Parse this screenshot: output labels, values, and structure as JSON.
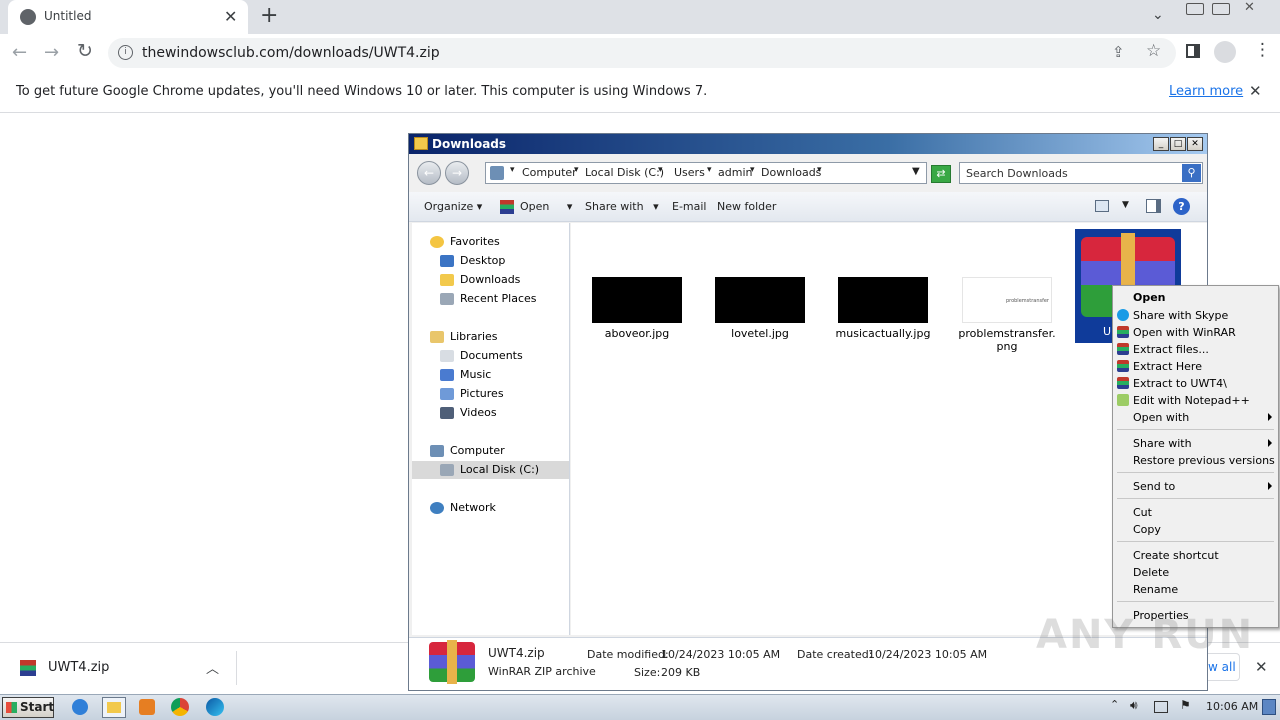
{
  "browser": {
    "tab_title": "Untitled",
    "new_tab_symbol": "+",
    "url": "thewindowsclub.com/downloads/UWT4.zip",
    "infobar_message": "To get future Google Chrome updates, you'll need Windows 10 or later. This computer is using Windows 7.",
    "infobar_link": "Learn more",
    "download_item": "UWT4.zip",
    "show_all_fragment": "w all"
  },
  "explorer": {
    "title": "Downloads",
    "breadcrumb": [
      "Computer",
      "Local Disk (C:)",
      "Users",
      "admin",
      "Downloads"
    ],
    "search_placeholder": "Search Downloads",
    "commands": {
      "organize": "Organize",
      "open": "Open",
      "share_with": "Share with",
      "email": "E-mail",
      "new_folder": "New folder"
    },
    "nav": {
      "favorites": "Favorites",
      "desktop": "Desktop",
      "downloads": "Downloads",
      "recent_places": "Recent Places",
      "libraries": "Libraries",
      "documents": "Documents",
      "music": "Music",
      "pictures": "Pictures",
      "videos": "Videos",
      "computer": "Computer",
      "local_disk": "Local Disk (C:)",
      "network": "Network"
    },
    "files": [
      {
        "name": "aboveor.jpg"
      },
      {
        "name": "lovetel.jpg"
      },
      {
        "name": "musicactually.jpg"
      },
      {
        "name": "problemstransfer.png",
        "thumb_text": "problemstransfer"
      },
      {
        "name": "UWT4.zip",
        "partial_label": "U"
      }
    ],
    "details": {
      "name": "UWT4.zip",
      "type": "WinRAR ZIP archive",
      "modified_label": "Date modified:",
      "modified_value": "10/24/2023 10:05 AM",
      "created_label": "Date created:",
      "created_value": "10/24/2023 10:05 AM",
      "size_label": "Size:",
      "size_value": "209 KB"
    }
  },
  "context_menu": {
    "open": "Open",
    "share_skype": "Share with Skype",
    "open_winrar": "Open with WinRAR",
    "extract_files": "Extract files...",
    "extract_here": "Extract Here",
    "extract_to": "Extract to UWT4\\",
    "edit_notepad": "Edit with Notepad++",
    "open_with": "Open with",
    "share_with": "Share with",
    "restore": "Restore previous versions",
    "send_to": "Send to",
    "cut": "Cut",
    "copy": "Copy",
    "create_shortcut": "Create shortcut",
    "delete": "Delete",
    "rename": "Rename",
    "properties": "Properties"
  },
  "taskbar": {
    "start": "Start",
    "clock": "10:06 AM"
  },
  "watermark": "ANY RUN",
  "colors": {
    "accent_blue": "#1a73e8",
    "selection": "#cce8ff",
    "win_title": "#0a246a"
  }
}
